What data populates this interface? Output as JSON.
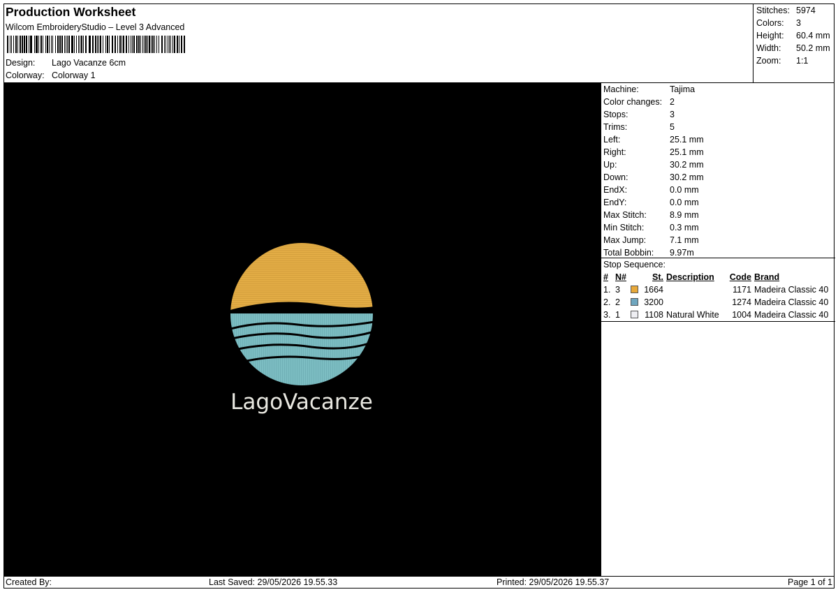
{
  "header": {
    "title": "Production Worksheet",
    "subtitle": "Wilcom EmbroideryStudio – Level 3 Advanced",
    "design_label": "Design:",
    "design_value": "Lago Vacanze 6cm",
    "colorway_label": "Colorway:",
    "colorway_value": "Colorway 1"
  },
  "stats": [
    {
      "label": "Stitches:",
      "value": "5974"
    },
    {
      "label": "Colors:",
      "value": "3"
    },
    {
      "label": "Height:",
      "value": "60.4 mm"
    },
    {
      "label": "Width:",
      "value": "50.2 mm"
    },
    {
      "label": "Zoom:",
      "value": "1:1"
    }
  ],
  "machine": [
    {
      "label": "Machine:",
      "value": "Tajima"
    },
    {
      "label": "Color changes:",
      "value": "2"
    },
    {
      "label": "Stops:",
      "value": "3"
    },
    {
      "label": "Trims:",
      "value": "5"
    },
    {
      "label": "Left:",
      "value": "25.1 mm"
    },
    {
      "label": "Right:",
      "value": "25.1 mm"
    },
    {
      "label": "Up:",
      "value": "30.2 mm"
    },
    {
      "label": "Down:",
      "value": "30.2 mm"
    },
    {
      "label": "EndX:",
      "value": "0.0 mm"
    },
    {
      "label": "EndY:",
      "value": "0.0 mm"
    },
    {
      "label": "Max Stitch:",
      "value": "8.9 mm"
    },
    {
      "label": "Min Stitch:",
      "value": "0.3 mm"
    },
    {
      "label": "Max Jump:",
      "value": "7.1 mm"
    },
    {
      "label": "Total Bobbin:",
      "value": "9.97m"
    }
  ],
  "stop_sequence": {
    "title": "Stop Sequence:",
    "headers": {
      "idx": "#",
      "n": "N#",
      "st": "St.",
      "desc": "Description",
      "code": "Code",
      "brand": "Brand"
    },
    "rows": [
      {
        "idx": "1.",
        "n": "3",
        "color": "#e8a93a",
        "st": "1664",
        "desc": "",
        "code": "1171",
        "brand": "Madeira Classic 40"
      },
      {
        "idx": "2.",
        "n": "2",
        "color": "#6fa6bf",
        "st": "3200",
        "desc": "",
        "code": "1274",
        "brand": "Madeira Classic 40"
      },
      {
        "idx": "3.",
        "n": "1",
        "color": "#eeeef2",
        "st": "1108",
        "desc": "Natural White",
        "code": "1004",
        "brand": "Madeira Classic 40"
      }
    ]
  },
  "design": {
    "logo_text": "LagoVacanze",
    "sun_color": "#e2ac45",
    "water_color": "#7cbdc2",
    "text_color": "#e9e8e1",
    "background": "#000000"
  },
  "footer": {
    "created_by": "Created By:",
    "last_saved": "Last Saved: 29/05/2026 19.55.33",
    "printed": "Printed: 29/05/2026 19.55.37",
    "page": "Page 1 of 1"
  }
}
